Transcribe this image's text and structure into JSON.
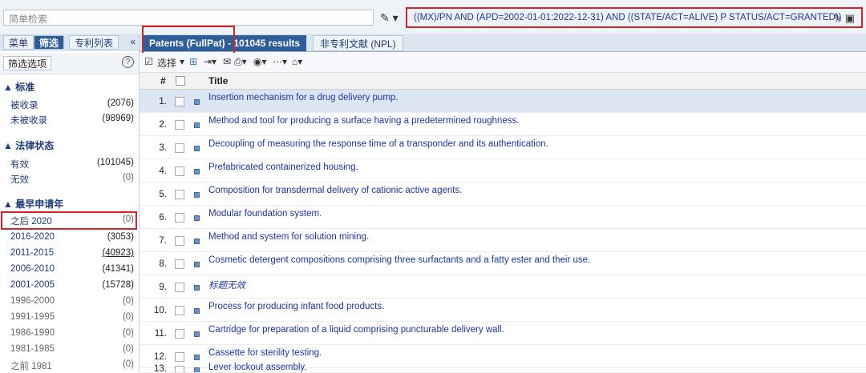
{
  "search": {
    "placeholder": "简单检索",
    "query": "((MX)/PN AND (APD=2002-01-01:2022-12-31) AND ((STATE/ACT=ALIVE) P STATUS/ACT=GRANTED))"
  },
  "left_tabs": [
    {
      "label": "菜单"
    },
    {
      "label": "筛选"
    },
    {
      "label": "专利列表"
    }
  ],
  "left_collapse": "«",
  "filter": {
    "button_label": "筛选选项",
    "help_label": "?",
    "sections": [
      {
        "title": "▲ 标准",
        "items": [
          {
            "label": "被收录",
            "count": "(2076)"
          },
          {
            "label": "未被收录",
            "count": "(98969)"
          }
        ]
      },
      {
        "title": "▲ 法律状态",
        "items": [
          {
            "label": "有效",
            "count": "(101045)"
          },
          {
            "label": "无效",
            "count": "(0)"
          }
        ]
      },
      {
        "title": "▲ 最早申请年",
        "items": [
          {
            "label": "之后 2020",
            "count": "(0)"
          },
          {
            "label": "2016-2020",
            "count": "(3053)"
          },
          {
            "label": "2011-2015",
            "count": "(40923)"
          },
          {
            "label": "2006-2010",
            "count": "(41341)"
          },
          {
            "label": "2001-2005",
            "count": "(15728)"
          },
          {
            "label": "1996-2000",
            "count": "(0)"
          },
          {
            "label": "1991-1995",
            "count": "(0)"
          },
          {
            "label": "1986-1990",
            "count": "(0)"
          },
          {
            "label": "1981-1985",
            "count": "(0)"
          },
          {
            "label": "之前 1981",
            "count": "(0)"
          }
        ]
      }
    ]
  },
  "main_tabs": [
    {
      "label": "Patents (FullPat) - 101045 results"
    },
    {
      "label": "非专利文献 (NPL)"
    }
  ],
  "toolbar": {
    "select_label": "选择"
  },
  "table": {
    "headers": {
      "hash": "#",
      "title": "Title"
    },
    "rows": [
      {
        "num": "1.",
        "title": "Insertion mechanism for a drug delivery pump."
      },
      {
        "num": "2.",
        "title": "Method and tool for producing a surface having a predetermined roughness."
      },
      {
        "num": "3.",
        "title": "Decoupling of measuring the response time of a transponder and its authentication."
      },
      {
        "num": "4.",
        "title": "Prefabricated containerized housing."
      },
      {
        "num": "5.",
        "title": "Composition for transdermal delivery of cationic active agents."
      },
      {
        "num": "6.",
        "title": "Modular foundation system."
      },
      {
        "num": "7.",
        "title": "Method and system for solution mining."
      },
      {
        "num": "8.",
        "title": "Cosmetic detergent compositions comprising three surfactants and a fatty ester and their use."
      },
      {
        "num": "9.",
        "title": "标题无效"
      },
      {
        "num": "10.",
        "title": "Process for producing infant food products."
      },
      {
        "num": "11.",
        "title": "Cartridge for preparation of a liquid comprising puncturable delivery wall."
      },
      {
        "num": "12.",
        "title": "Cassette for sterility testing."
      },
      {
        "num": "13.",
        "title": "Lever lockout assembly."
      }
    ]
  },
  "colors": {
    "accent": "#2f5d9a",
    "highlight": "#d8232a",
    "link": "#1d35a8"
  }
}
